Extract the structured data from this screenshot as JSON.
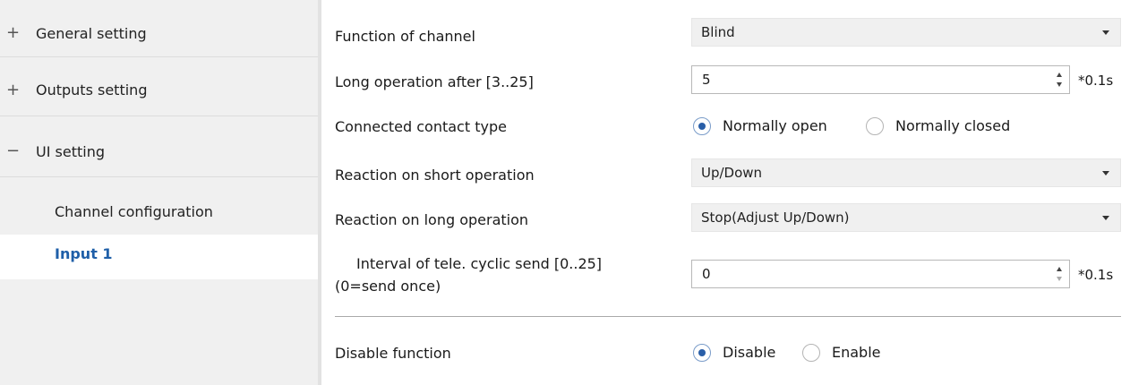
{
  "sidebar": {
    "items": [
      {
        "sign": "+",
        "label": "General setting"
      },
      {
        "sign": "+",
        "label": "Outputs setting"
      },
      {
        "sign": "−",
        "label": "UI setting"
      }
    ],
    "sub_items": [
      {
        "label": "Channel configuration",
        "active": false
      },
      {
        "label": "Input 1",
        "active": true
      }
    ],
    "active_color": "#1f5fa8"
  },
  "params": {
    "function_of_channel": {
      "label": "Function of channel",
      "value": "Blind"
    },
    "long_operation_after": {
      "label": "Long operation after [3..25]",
      "value": "5",
      "unit": "*0.1s"
    },
    "connected_contact_type": {
      "label": "Connected contact type",
      "options": [
        "Normally open",
        "Normally closed"
      ],
      "selected": "Normally open"
    },
    "reaction_short": {
      "label": "Reaction on short operation",
      "value": "Up/Down"
    },
    "reaction_long": {
      "label": "Reaction on long operation",
      "value": "Stop(Adjust Up/Down)"
    },
    "interval_cyclic": {
      "label_line1": "Interval of tele. cyclic send [0..25]",
      "label_line2": "(0=send once)",
      "value": "0",
      "unit": "*0.1s"
    },
    "disable_function": {
      "label": "Disable function",
      "options": [
        "Disable",
        "Enable"
      ],
      "selected": "Disable"
    }
  }
}
